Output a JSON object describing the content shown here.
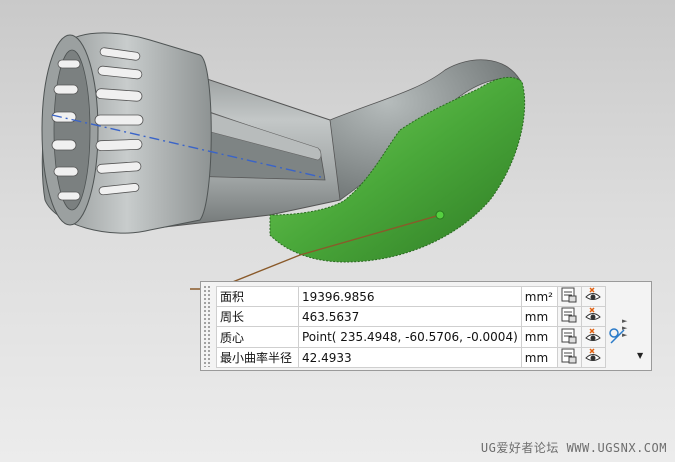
{
  "measurements": [
    {
      "label": "面积",
      "value": "19396.9856",
      "unit": "mm²"
    },
    {
      "label": "周长",
      "value": "463.5637",
      "unit": "mm"
    },
    {
      "label": "质心",
      "value": "Point( 235.4948, -60.5706, -0.0004)",
      "unit": "mm"
    },
    {
      "label": "最小曲率半径",
      "value": "42.4933",
      "unit": "mm"
    }
  ],
  "icons": {
    "export": "export-to-spreadsheet-icon",
    "visibility": "show-hide-eye-icon",
    "associative": "associative-measure-icon",
    "expand": "expand-arrows-icon",
    "dropdown": "dropdown-arrow-icon"
  },
  "colors": {
    "selected_face": "#4aa83a",
    "part_body": "#a9aeae",
    "centerline": "#3a64c8",
    "leader_line": "#8a5a2a"
  },
  "watermark": "UG爱好者论坛 WWW.UGSNX.COM"
}
